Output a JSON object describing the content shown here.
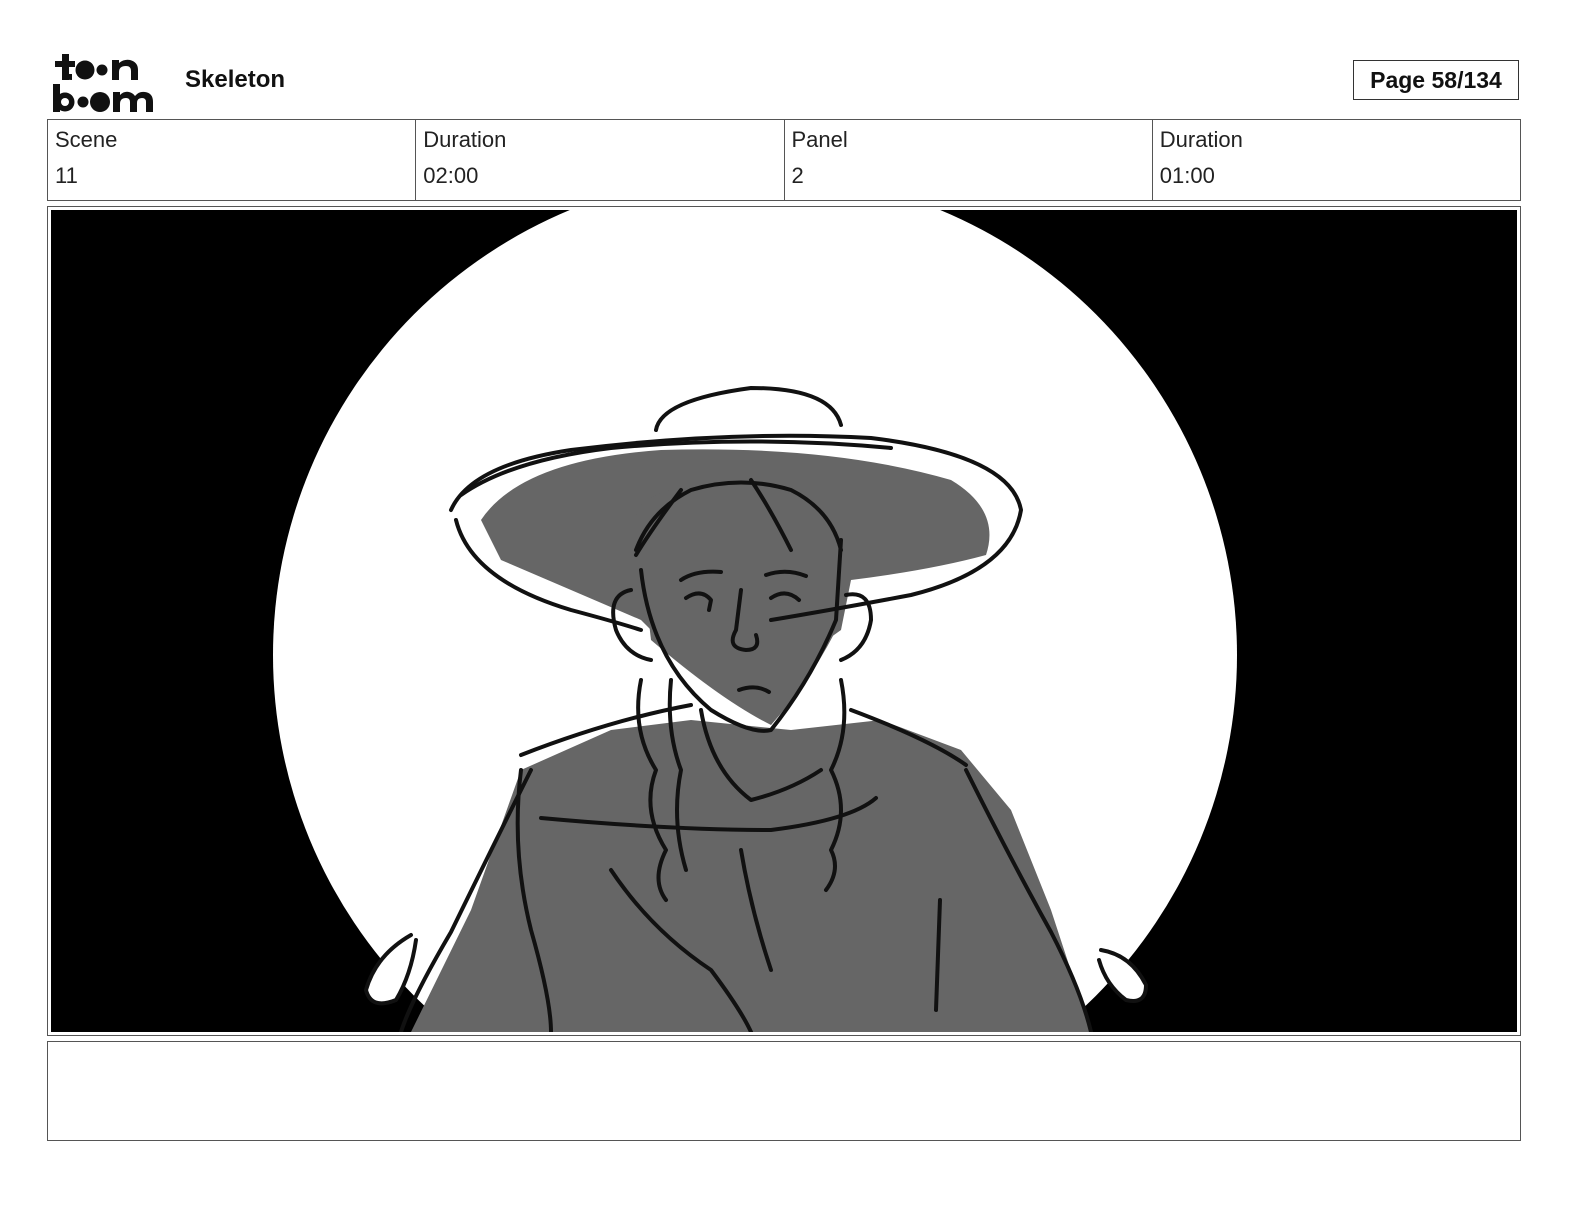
{
  "header": {
    "logo_alt": "toon boom",
    "project_title": "Skeleton",
    "page_label": "Page",
    "page_number": "58/134"
  },
  "info": [
    {
      "label": "Scene",
      "value": "11"
    },
    {
      "label": "Duration",
      "value": "02:00"
    },
    {
      "label": "Panel",
      "value": "2"
    },
    {
      "label": "Duration",
      "value": "01:00"
    }
  ],
  "panel": {
    "description": "",
    "colors": {
      "background": "#000000",
      "spotlight": "#ffffff",
      "shade": "#666666",
      "ink": "#111111"
    }
  },
  "notes": ""
}
